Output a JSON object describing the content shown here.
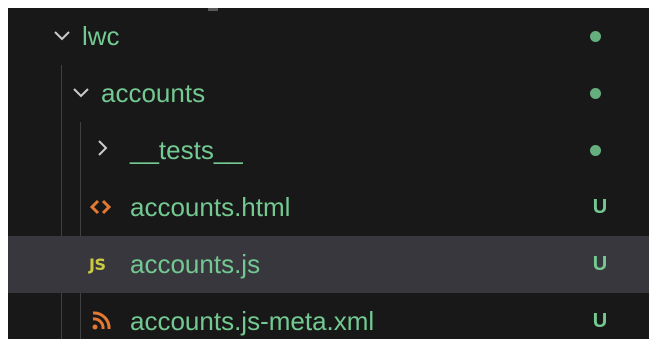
{
  "explorer": {
    "items": [
      {
        "label": "lwc",
        "kind": "folder",
        "expanded": true,
        "status": "",
        "status_color": "#73c991"
      },
      {
        "label": "accounts",
        "kind": "folder",
        "expanded": true,
        "status": "",
        "status_color": "#73c991"
      },
      {
        "label": "__tests__",
        "kind": "folder",
        "expanded": false,
        "status": "",
        "status_color": "#73c991"
      },
      {
        "label": "accounts.html",
        "kind": "file",
        "icon": "html-icon",
        "status": "U",
        "status_color": "#73c991"
      },
      {
        "label": "accounts.js",
        "kind": "file",
        "icon": "js-icon",
        "icon_text": "JS",
        "status": "U",
        "selected": true,
        "status_color": "#73c991"
      },
      {
        "label": "accounts.js-meta.xml",
        "kind": "file",
        "icon": "rss-icon",
        "status": "U",
        "status_color": "#73c991"
      }
    ]
  },
  "colors": {
    "background": "#181818",
    "selected_row": "#37373d",
    "untracked_text": "#73c991",
    "html_icon": "#e37933",
    "js_icon": "#cbcb41",
    "xml_icon": "#e37933"
  }
}
